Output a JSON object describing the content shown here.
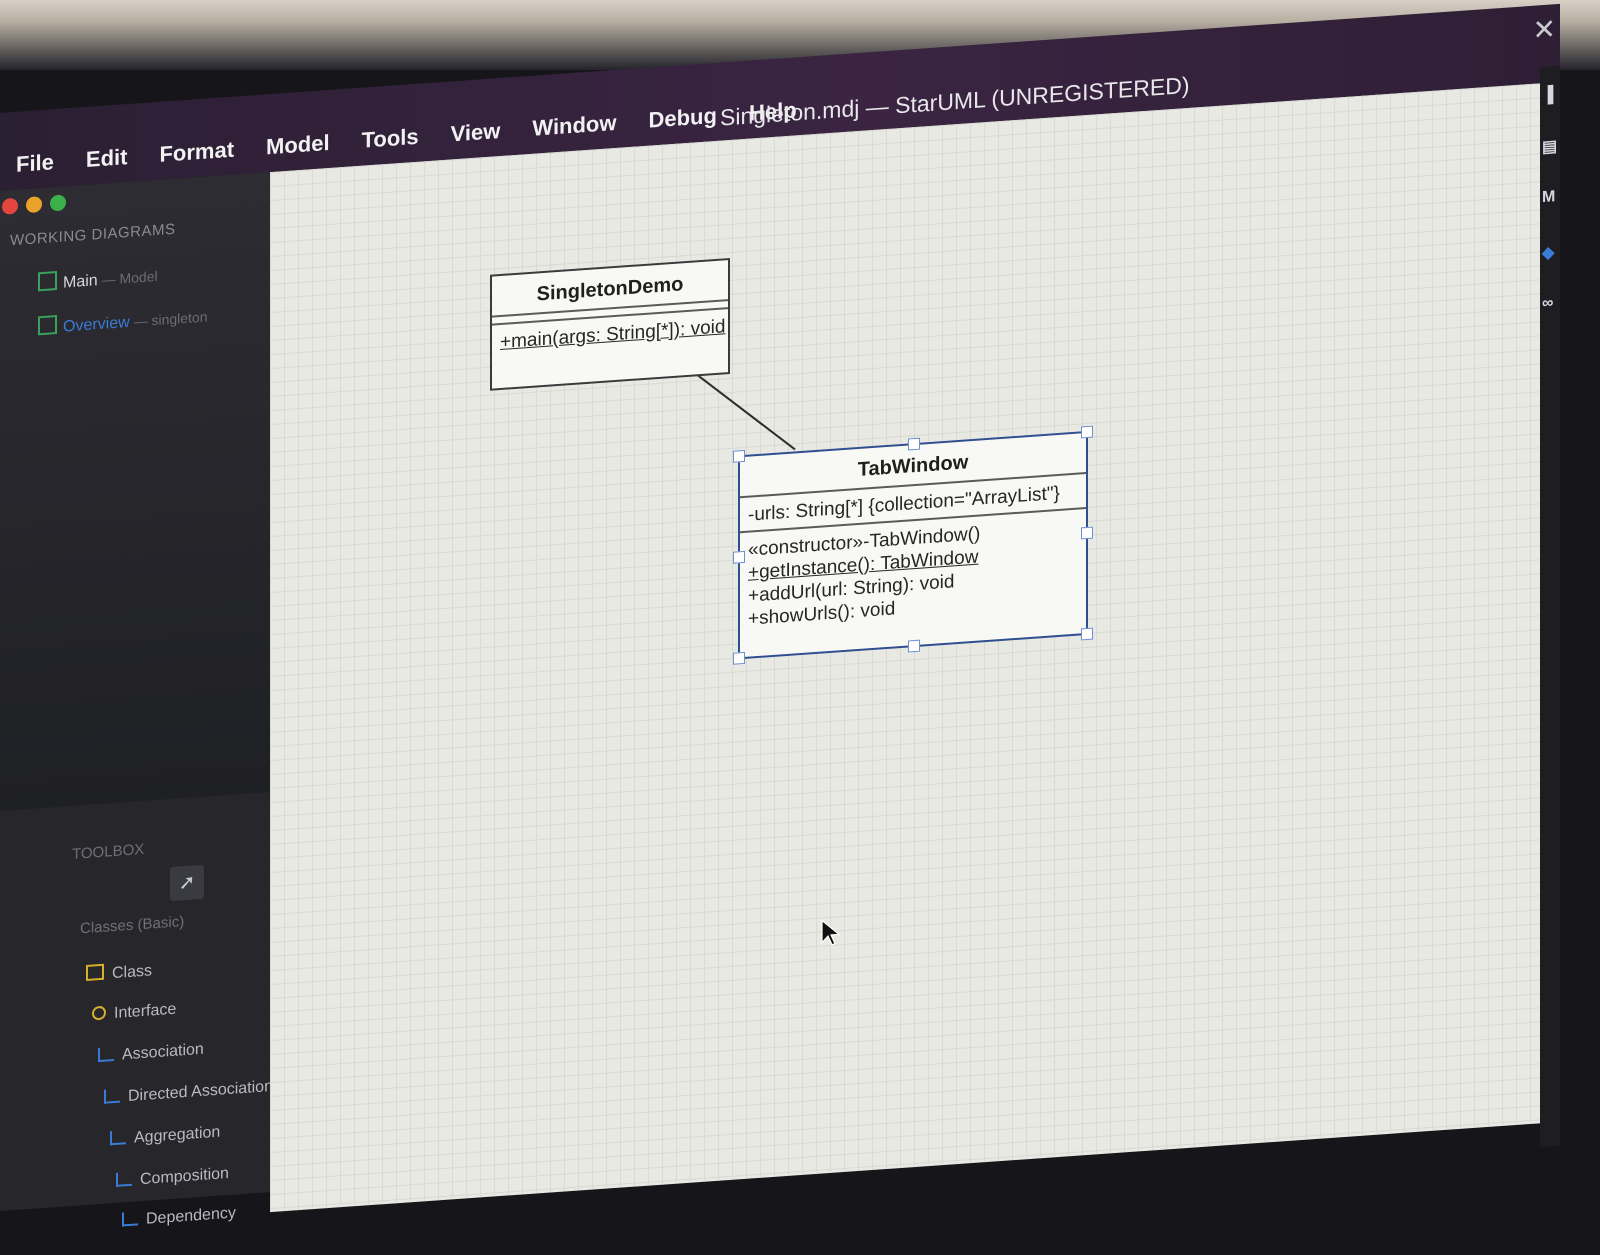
{
  "menu": [
    "File",
    "Edit",
    "Format",
    "Model",
    "Tools",
    "View",
    "Window",
    "Debug",
    "Help"
  ],
  "window_title": "Singleton.mdj — StarUML (UNREGISTERED)",
  "sidebar": {
    "working_diagrams_label": "WORKING DIAGRAMS",
    "working_diagrams": [
      {
        "name": "Main",
        "context": " — Model"
      },
      {
        "name": "Overview",
        "context": " — singleton"
      }
    ],
    "toolbox_label": "TOOLBOX",
    "classes_group_label": "Classes (Basic)",
    "tools": [
      "Class",
      "Interface",
      "Association",
      "Directed Association",
      "Aggregation",
      "Composition",
      "Dependency"
    ]
  },
  "diagram": {
    "singleton_demo": {
      "name": "SingletonDemo",
      "operations": [
        "+main(args: String[*]): void"
      ]
    },
    "tab_window": {
      "name": "TabWindow",
      "attributes": [
        "-urls: String[*] {collection=\"ArrayList\"}"
      ],
      "operations": [
        "«constructor»-TabWindow()",
        "+getInstance(): TabWindow",
        "+addUrl(url: String): void",
        "+showUrls(): void"
      ]
    }
  },
  "colors": {
    "titlebar": "#3a2442",
    "sidebar": "#26262b",
    "canvas": "#e9e9e4",
    "selection": "#6f8fd0",
    "overview_link": "#3a7bd5",
    "class_icon": "#d4b02a"
  },
  "icons": [
    "close-icon",
    "pointer-icon",
    "diagram-icon",
    "class-icon",
    "interface-icon",
    "association-icon"
  ]
}
